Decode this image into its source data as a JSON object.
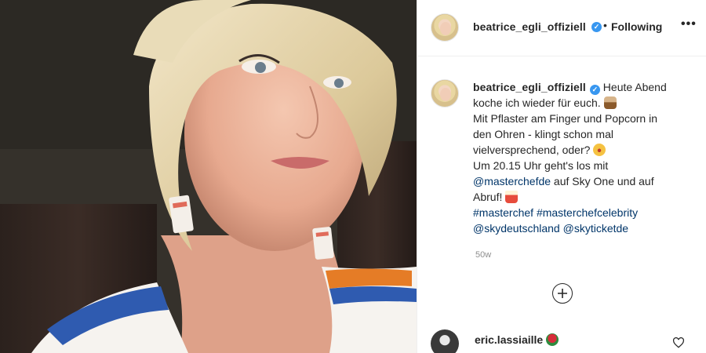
{
  "post": {
    "author": {
      "username": "beatrice_egli_offiziell",
      "verified_icon": "verified-badge-icon",
      "follow_state": "Following",
      "separator": "•"
    },
    "menu_icon": "more-options-icon",
    "menu_label": "•••",
    "caption": {
      "username": "beatrice_egli_offiziell",
      "line1": "Heute Abend",
      "line2": "koche ich wieder für euch.",
      "line3": "Mit Pflaster am Finger und Popcorn in",
      "line4": "den Ohren - klingt schon mal",
      "line5": "vielversprechend, oder?",
      "line6": "Um 20.15 Uhr geht's los mit",
      "mention1": "@masterchefde",
      "line7_rest": " auf Sky One und auf",
      "line8": "Abruf!",
      "hashtag1": "#masterchef",
      "hashtag2": "#masterchefcelebrity",
      "mention2": "@skydeutschland",
      "mention3": "@skyticketde"
    },
    "emojis": [
      "cooking-pan-emoji",
      "laughing-tears-emoji",
      "popcorn-emoji"
    ],
    "age": "50w",
    "load_more_icon": "plus-circle-icon",
    "link_color": "#003569",
    "verified_color": "#3897f0",
    "comments": [
      {
        "username": "eric.lassiaille",
        "emoji": "rose-emoji",
        "like_icon": "heart-outline-icon"
      }
    ]
  }
}
